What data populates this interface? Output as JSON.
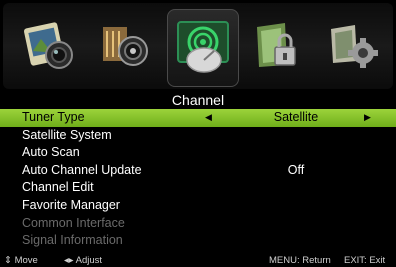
{
  "icons": [
    {
      "name": "picture-icon"
    },
    {
      "name": "sound-icon"
    },
    {
      "name": "channel-icon",
      "active": true
    },
    {
      "name": "lock-icon"
    },
    {
      "name": "setup-icon"
    }
  ],
  "menu": {
    "title": "Channel",
    "items": [
      {
        "label": "Tuner Type",
        "value": "Satellite",
        "selected": true
      },
      {
        "label": "Satellite System",
        "value": ""
      },
      {
        "label": "Auto Scan",
        "value": ""
      },
      {
        "label": "Auto Channel Update",
        "value": "Off"
      },
      {
        "label": "Channel Edit",
        "value": ""
      },
      {
        "label": "Favorite Manager",
        "value": ""
      },
      {
        "label": "Common Interface",
        "value": "",
        "disabled": true
      },
      {
        "label": "Signal Information",
        "value": "",
        "disabled": true
      }
    ]
  },
  "footer": {
    "move_glyph": "⇕",
    "move_label": "Move",
    "adjust_glyph": "◂▸",
    "adjust_label": "Adjust",
    "menu_hint": "MENU: Return",
    "exit_hint": "EXIT: Exit"
  },
  "colors": {
    "selected_row": "#8cc63f",
    "disabled_text": "#6a6a6a"
  }
}
